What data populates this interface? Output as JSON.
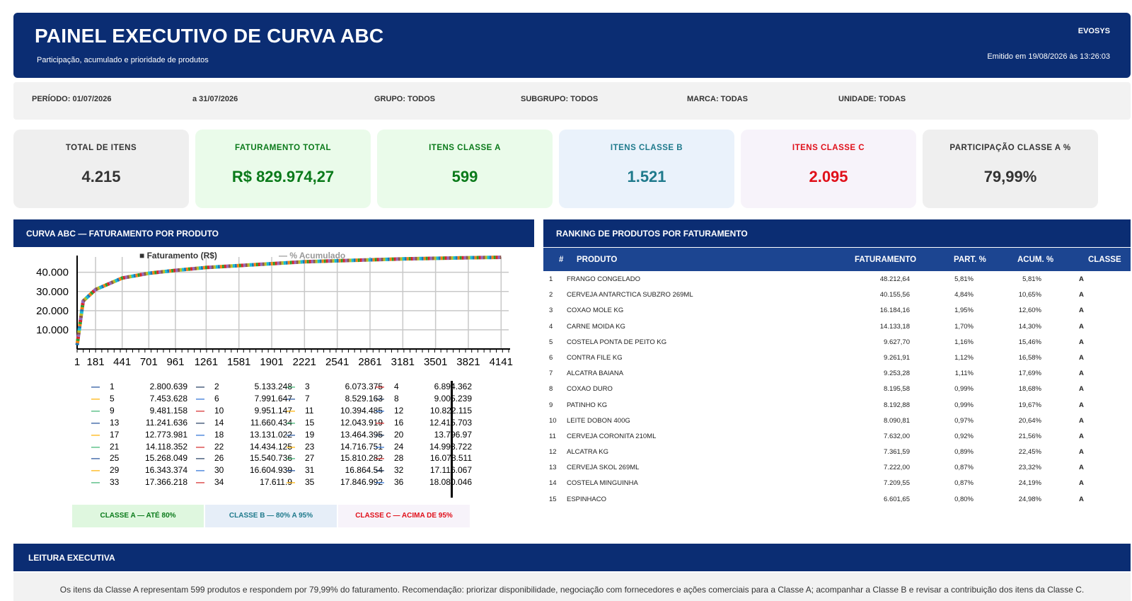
{
  "header": {
    "title": "PAINEL EXECUTIVO DE CURVA ABC",
    "subtitle": "Participação, acumulado e prioridade de produtos",
    "brand": "EVOSYS",
    "emitted": "Emitido em 19/08/2026 às 13:26:03"
  },
  "filters": {
    "period": "PERÍODO: 01/07/2026",
    "period_end": "a 31/07/2026",
    "group": "GRUPO: TODOS",
    "subgroup": "SUBGRUPO: TODOS",
    "brand": "MARCA: TODAS",
    "unit": "UNIDADE: TODAS"
  },
  "kpis": [
    {
      "label": "TOTAL DE ITENS",
      "value": "4.215",
      "color": "#333333",
      "bg": "#efefef"
    },
    {
      "label": "FATURAMENTO TOTAL",
      "value": "R$ 829.974,27",
      "color": "#0a7a1a",
      "bg": "#eafbea"
    },
    {
      "label": "ITENS CLASSE A",
      "value": "599",
      "color": "#0a7a1a",
      "bg": "#eafbea"
    },
    {
      "label": "ITENS CLASSE B",
      "value": "1.521",
      "color": "#1f7a8c",
      "bg": "#eaf2fb"
    },
    {
      "label": "ITENS CLASSE C",
      "value": "2.095",
      "color": "#e0101a",
      "bg": "#f7f3fa"
    },
    {
      "label": "PARTICIPAÇÃO CLASSE A %",
      "value": "79,99%",
      "color": "#333333",
      "bg": "#efefef"
    }
  ],
  "chart_panel": {
    "title": "CURVA ABC — FATURAMENTO POR PRODUTO"
  },
  "chart_data": {
    "type": "line",
    "legend": {
      "faturamento": "Faturamento (R$)",
      "acumulado": "% Acumulado"
    },
    "yticks": [
      "40.000",
      "30.000",
      "20.000",
      "10.000"
    ],
    "xticks": [
      "1",
      "181",
      "441",
      "701",
      "961",
      "1261",
      "1581",
      "1901",
      "2221",
      "2541",
      "2861",
      "3181",
      "3501",
      "3821",
      "4141"
    ],
    "ylim": [
      0,
      48000
    ],
    "x": [
      1,
      60,
      181,
      441,
      701,
      961,
      1261,
      1581,
      1901,
      2221,
      2541,
      2861,
      3181,
      3501,
      3821,
      4141
    ],
    "values": [
      2000,
      25000,
      31000,
      37000,
      39500,
      41000,
      42500,
      43500,
      44500,
      45500,
      46000,
      46500,
      47000,
      47300,
      47600,
      47800
    ],
    "grid": true
  },
  "series_legend": [
    [
      [
        "1",
        "2.800.639"
      ],
      [
        "2",
        "5.133.248"
      ],
      [
        "3",
        "6.073.375"
      ],
      [
        "4",
        "6.894.362"
      ]
    ],
    [
      [
        "5",
        "7.453.628"
      ],
      [
        "6",
        "7.991.647"
      ],
      [
        "7",
        "8.529.163"
      ],
      [
        "8",
        "9.005.239"
      ]
    ],
    [
      [
        "9",
        "9.481.158"
      ],
      [
        "10",
        "9.951.147"
      ],
      [
        "11",
        "10.394.485"
      ],
      [
        "12",
        "10.822.115"
      ]
    ],
    [
      [
        "13",
        "11.241.636"
      ],
      [
        "14",
        "11.660.434"
      ],
      [
        "15",
        "12.043.919"
      ],
      [
        "16",
        "12.415.703"
      ]
    ],
    [
      [
        "17",
        "12.773.981"
      ],
      [
        "18",
        "13.131.022"
      ],
      [
        "19",
        "13.464.395"
      ],
      [
        "20",
        "13.796.97"
      ]
    ],
    [
      [
        "21",
        "14.118.352"
      ],
      [
        "22",
        "14.434.125"
      ],
      [
        "23",
        "14.716.751"
      ],
      [
        "24",
        "14.993.722"
      ]
    ],
    [
      [
        "25",
        "15.268.049"
      ],
      [
        "26",
        "15.540.736"
      ],
      [
        "27",
        "15.810.282"
      ],
      [
        "28",
        "16.078.511"
      ]
    ],
    [
      [
        "29",
        "16.343.374"
      ],
      [
        "30",
        "16.604.939"
      ],
      [
        "31",
        "16.864.54"
      ],
      [
        "32",
        "17.116.067"
      ]
    ],
    [
      [
        "33",
        "17.366.218"
      ],
      [
        "34",
        "17.611.9"
      ],
      [
        "35",
        "17.846.992"
      ],
      [
        "36",
        "18.080.046"
      ]
    ]
  ],
  "class_legend": [
    {
      "label": "CLASSE A — ATÉ 80%",
      "color": "#0a7a1a",
      "bg": "#dff7df"
    },
    {
      "label": "CLASSE B — 80% A 95%",
      "color": "#1f7a8c",
      "bg": "#e6eef8"
    },
    {
      "label": "CLASSE C — ACIMA DE 95%",
      "color": "#e0101a",
      "bg": "#f7f3fa"
    }
  ],
  "ranking": {
    "title": "RANKING DE PRODUTOS POR FATURAMENTO",
    "columns": [
      "#",
      "PRODUTO",
      "FATURAMENTO",
      "PART. %",
      "ACUM. %",
      "CLASSE"
    ],
    "rows": [
      [
        "1",
        "FRANGO CONGELADO",
        "48.212,64",
        "5,81%",
        "5,81%",
        "A"
      ],
      [
        "2",
        "CERVEJA ANTARCTICA SUBZRO 269ML",
        "40.155,56",
        "4,84%",
        "10,65%",
        "A"
      ],
      [
        "3",
        "COXAO MOLE KG",
        "16.184,16",
        "1,95%",
        "12,60%",
        "A"
      ],
      [
        "4",
        "CARNE MOIDA KG",
        "14.133,18",
        "1,70%",
        "14,30%",
        "A"
      ],
      [
        "5",
        "COSTELA PONTA DE PEITO KG",
        "9.627,70",
        "1,16%",
        "15,46%",
        "A"
      ],
      [
        "6",
        "CONTRA FILE KG",
        "9.261,91",
        "1,12%",
        "16,58%",
        "A"
      ],
      [
        "7",
        "ALCATRA BAIANA",
        "9.253,28",
        "1,11%",
        "17,69%",
        "A"
      ],
      [
        "8",
        "COXAO DURO",
        "8.195,58",
        "0,99%",
        "18,68%",
        "A"
      ],
      [
        "9",
        "PATINHO KG",
        "8.192,88",
        "0,99%",
        "19,67%",
        "A"
      ],
      [
        "10",
        "LEITE DOBON 400G",
        "8.090,81",
        "0,97%",
        "20,64%",
        "A"
      ],
      [
        "11",
        "CERVEJA CORONITA 210ML",
        "7.632,00",
        "0,92%",
        "21,56%",
        "A"
      ],
      [
        "12",
        "ALCATRA KG",
        "7.361,59",
        "0,89%",
        "22,45%",
        "A"
      ],
      [
        "13",
        "CERVEJA SKOL 269ML",
        "7.222,00",
        "0,87%",
        "23,32%",
        "A"
      ],
      [
        "14",
        "COSTELA MINGUINHA",
        "7.209,55",
        "0,87%",
        "24,19%",
        "A"
      ],
      [
        "15",
        "ESPINHACO",
        "6.601,65",
        "0,80%",
        "24,98%",
        "A"
      ]
    ]
  },
  "executive": {
    "title": "LEITURA EXECUTIVA",
    "text": "Os itens da Classe A representam 599 produtos e respondem por 79,99% do faturamento. Recomendação: priorizar disponibilidade, negociação com fornecedores e ações comerciais para a Classe A; acompanhar a Classe B e revisar a contribuição dos itens da Classe C."
  }
}
